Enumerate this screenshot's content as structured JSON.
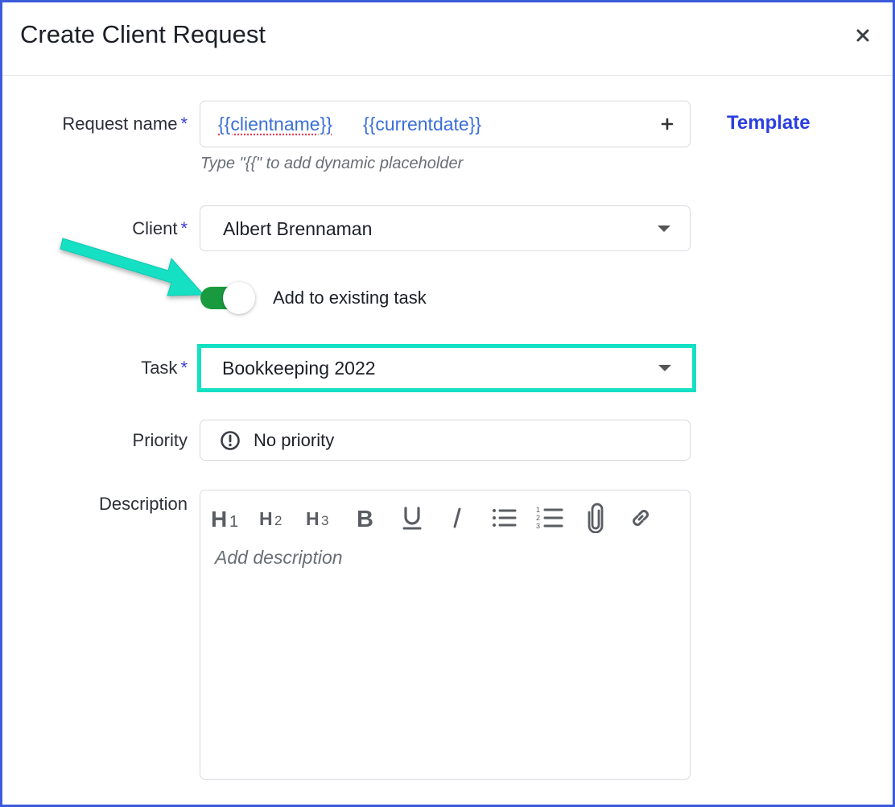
{
  "dialog": {
    "title": "Create Client Request",
    "close_icon": "close-icon"
  },
  "form": {
    "request_name": {
      "label": "Request name",
      "required_marker": "*",
      "placeholders": [
        "{{clientname}}",
        "{{currentdate}}"
      ],
      "add_icon": "plus-icon",
      "hint": "Type \"{{\" to add dynamic placeholder",
      "template_link": "Template"
    },
    "client": {
      "label": "Client",
      "required_marker": "*",
      "value": "Albert Brennaman"
    },
    "add_to_existing_task": {
      "label": "Add to existing task",
      "enabled": true
    },
    "task": {
      "label": "Task",
      "required_marker": "*",
      "value": "Bookkeeping 2022"
    },
    "priority": {
      "label": "Priority",
      "icon": "exclamation-circle-icon",
      "value": "No priority"
    },
    "description": {
      "label": "Description",
      "placeholder": "Add description",
      "toolbar": [
        {
          "name": "heading-1",
          "glyph": "H1"
        },
        {
          "name": "heading-2",
          "glyph": "H2"
        },
        {
          "name": "heading-3",
          "glyph": "H3"
        },
        {
          "name": "bold",
          "glyph": "B"
        },
        {
          "name": "underline",
          "glyph": "U"
        },
        {
          "name": "italic",
          "glyph": "I"
        },
        {
          "name": "bullet-list",
          "glyph": "list"
        },
        {
          "name": "numbered-list",
          "glyph": "123"
        },
        {
          "name": "attachment",
          "glyph": "paperclip"
        },
        {
          "name": "link",
          "glyph": "link"
        }
      ]
    }
  },
  "colors": {
    "border_accent": "#3b5bdb",
    "required": "#3b3fd8",
    "link": "#2b3ee0",
    "toggle_on": "#1a9a3f",
    "annotation": "#14e0c4",
    "placeholder_token": "#3a6fd8"
  }
}
